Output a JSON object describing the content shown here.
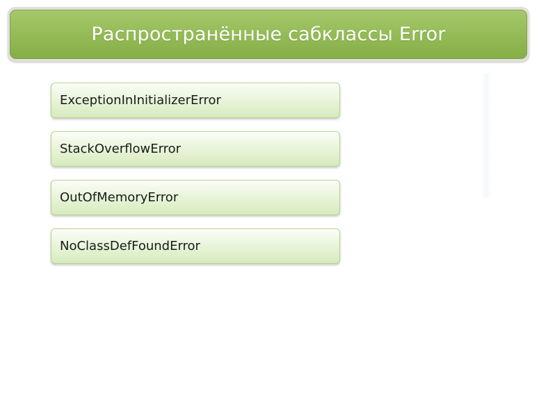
{
  "slide": {
    "title": "Распространённые сабклассы Error",
    "items": [
      {
        "label": "ExceptionInInitializerError"
      },
      {
        "label": "StackOverflowError"
      },
      {
        "label": "OutOfMemoryError"
      },
      {
        "label": "NoClassDefFoundError"
      }
    ]
  },
  "colors": {
    "title_bar": "#93ba55",
    "title_text": "#ffffff",
    "item_fill_top": "#fbfdf7",
    "item_fill_bottom": "#d6ebbd",
    "item_border": "#b5d48a"
  }
}
